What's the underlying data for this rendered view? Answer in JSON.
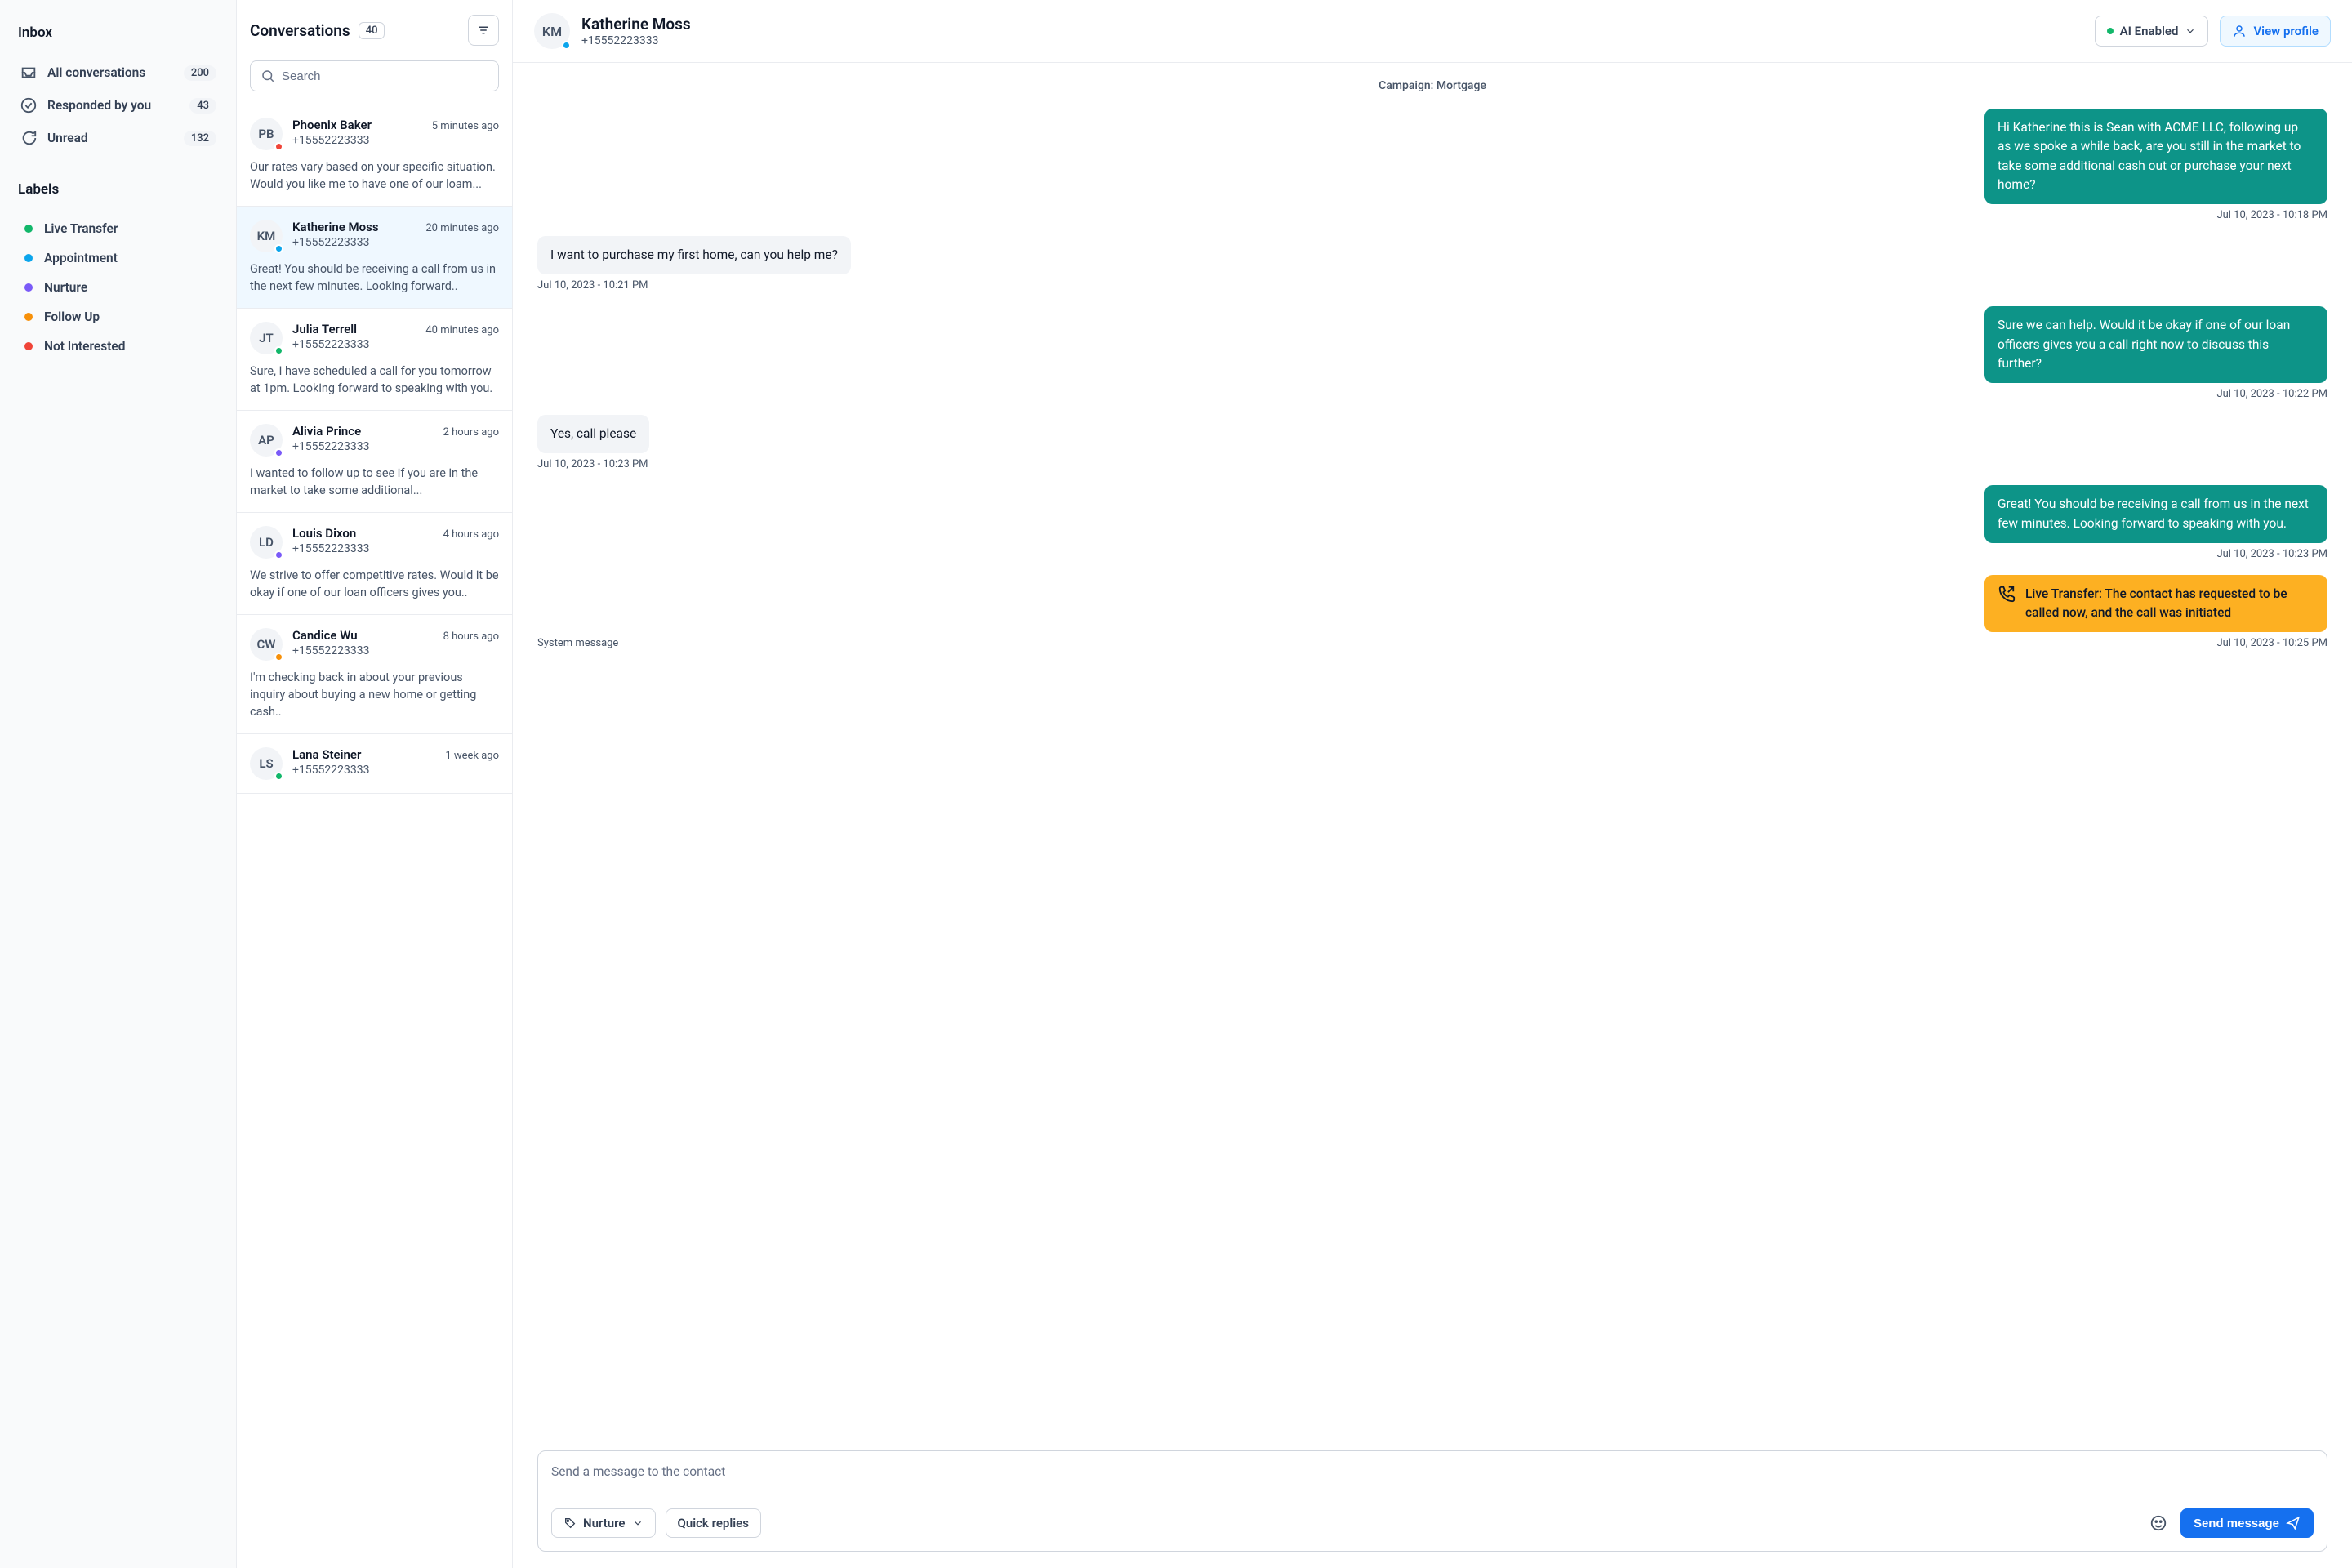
{
  "sidebar": {
    "inbox_title": "Inbox",
    "nav": [
      {
        "label": "All conversations",
        "count": "200"
      },
      {
        "label": "Responded by you",
        "count": "43"
      },
      {
        "label": "Unread",
        "count": "132"
      }
    ],
    "labels_title": "Labels",
    "labels": [
      {
        "label": "Live Transfer",
        "color": "#12b76a"
      },
      {
        "label": "Appointment",
        "color": "#0ba5ec"
      },
      {
        "label": "Nurture",
        "color": "#7a5af8"
      },
      {
        "label": "Follow Up",
        "color": "#f79009"
      },
      {
        "label": "Not Interested",
        "color": "#f04438"
      }
    ]
  },
  "conversations": {
    "title": "Conversations",
    "count": "40",
    "search_placeholder": "Search",
    "items": [
      {
        "initials": "PB",
        "name": "Phoenix Baker",
        "phone": "+15552223333",
        "time": "5 minutes ago",
        "preview": "Our rates vary based on your specific situation. Would you like me to have one of our loam...",
        "status": "#f04438"
      },
      {
        "initials": "KM",
        "name": "Katherine Moss",
        "phone": "+15552223333",
        "time": "20 minutes ago",
        "preview": "Great! You should be receiving a call from us in the next few minutes. Looking forward..",
        "status": "#0ba5ec",
        "active": true
      },
      {
        "initials": "JT",
        "name": "Julia Terrell",
        "phone": "+15552223333",
        "time": "40 minutes ago",
        "preview": "Sure, I have scheduled a call for you tomorrow at 1pm. Looking forward to speaking with you.",
        "status": "#12b76a"
      },
      {
        "initials": "AP",
        "name": "Alivia Prince",
        "phone": "+15552223333",
        "time": "2 hours ago",
        "preview": "I wanted to follow up to see if you are in the market to take some additional...",
        "status": "#7a5af8"
      },
      {
        "initials": "LD",
        "name": "Louis Dixon",
        "phone": "+15552223333",
        "time": "4 hours ago",
        "preview": "We strive to offer competitive rates. Would it be okay if one of our loan officers gives you..",
        "status": "#7a5af8"
      },
      {
        "initials": "CW",
        "name": "Candice Wu",
        "phone": "+15552223333",
        "time": "8 hours ago",
        "preview": "I'm checking back in about your previous inquiry about buying a new home or getting cash..",
        "status": "#f79009"
      },
      {
        "initials": "LS",
        "name": "Lana Steiner",
        "phone": "+15552223333",
        "time": "1 week ago",
        "preview": "",
        "status": "#12b76a"
      }
    ]
  },
  "chat": {
    "contact": {
      "initials": "KM",
      "name": "Katherine Moss",
      "phone": "+15552223333",
      "status": "#0ba5ec"
    },
    "ai_label": "AI Enabled",
    "view_profile_label": "View profile",
    "campaign": "Campaign: Mortgage",
    "messages": [
      {
        "dir": "out",
        "text": "Hi Katherine this is Sean with ACME LLC, following up as we spoke a while back, are you still in the market to take some additional cash out or purchase your next home?",
        "time": "Jul 10, 2023 - 10:18 PM"
      },
      {
        "dir": "in",
        "text": "I want to purchase my first home, can you help me?",
        "time": "Jul 10, 2023 - 10:21 PM"
      },
      {
        "dir": "out",
        "text": "Sure we can help. Would it be okay if one of our loan officers gives you a call right now to discuss this further?",
        "time": "Jul 10, 2023 - 10:22 PM"
      },
      {
        "dir": "in",
        "text": "Yes, call please",
        "time": "Jul 10, 2023 - 10:23 PM"
      },
      {
        "dir": "out",
        "text": "Great! You should be receiving a call from us in the next few minutes. Looking forward to speaking with you.",
        "time": "Jul 10, 2023 - 10:23 PM"
      },
      {
        "dir": "system",
        "text": "Live Transfer: The contact has requested to be called now, and the call was initiated",
        "time": "Jul 10, 2023 - 10:25 PM",
        "sys_label": "System message"
      }
    ],
    "composer": {
      "placeholder": "Send a message to the contact",
      "tag_label": "Nurture",
      "quick_label": "Quick replies",
      "send_label": "Send message"
    }
  }
}
